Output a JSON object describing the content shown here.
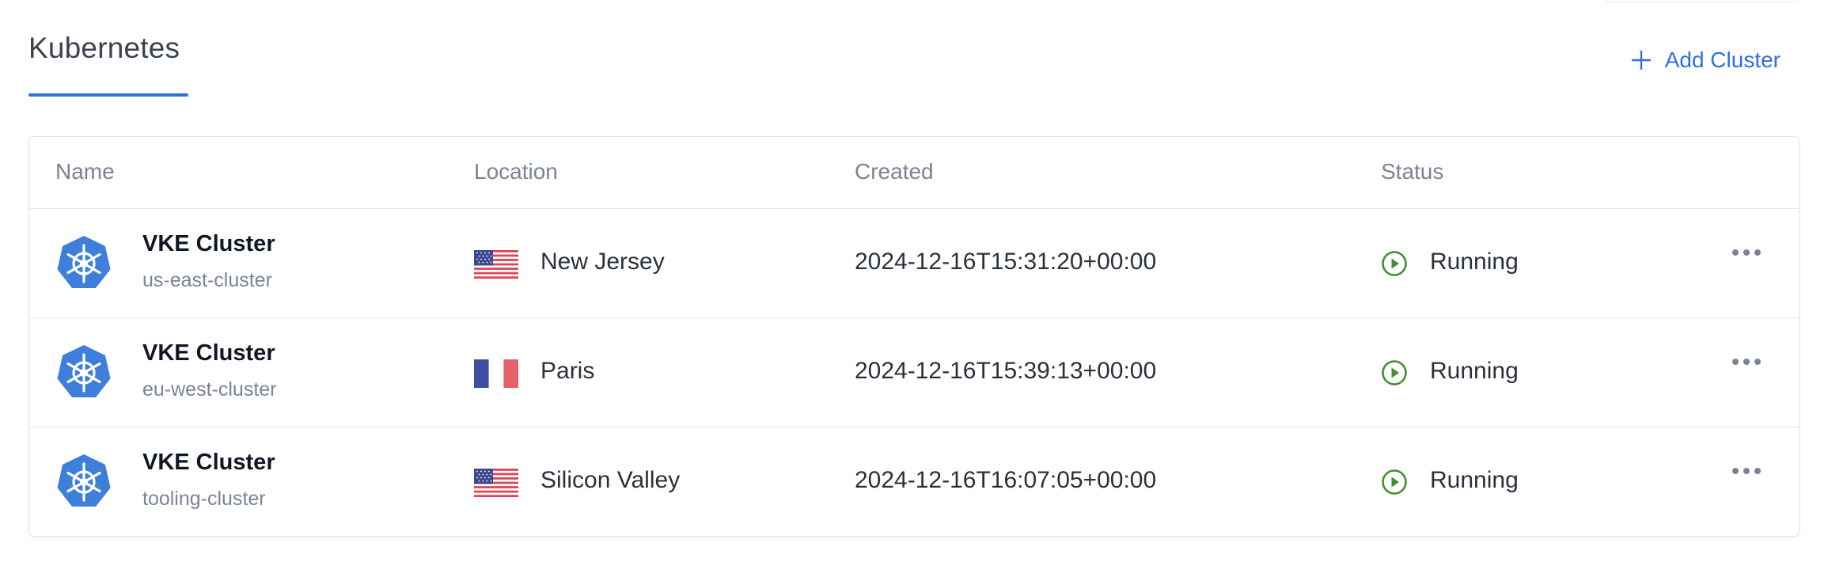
{
  "header": {
    "title": "Kubernetes",
    "add_cluster_label": "Add Cluster",
    "accent_color": "#2f6fde"
  },
  "table": {
    "columns": [
      "Name",
      "Location",
      "Created",
      "Status"
    ],
    "rows": [
      {
        "title": "VKE Cluster",
        "label": "us-east-cluster",
        "location": "New Jersey",
        "flag": "us",
        "created": "2024-12-16T15:31:20+00:00",
        "status": "Running"
      },
      {
        "title": "VKE Cluster",
        "label": "eu-west-cluster",
        "location": "Paris",
        "flag": "fr",
        "created": "2024-12-16T15:39:13+00:00",
        "status": "Running"
      },
      {
        "title": "VKE Cluster",
        "label": "tooling-cluster",
        "location": "Silicon Valley",
        "flag": "us",
        "created": "2024-12-16T16:07:05+00:00",
        "status": "Running"
      }
    ]
  },
  "icons": {
    "cluster": "kubernetes-icon",
    "status": "play-circle-icon",
    "more": "ellipsis-icon",
    "add": "plus-icon"
  },
  "colors": {
    "status_running": "#3f8f2f",
    "kubernetes_blue": "#3f7fdc"
  }
}
